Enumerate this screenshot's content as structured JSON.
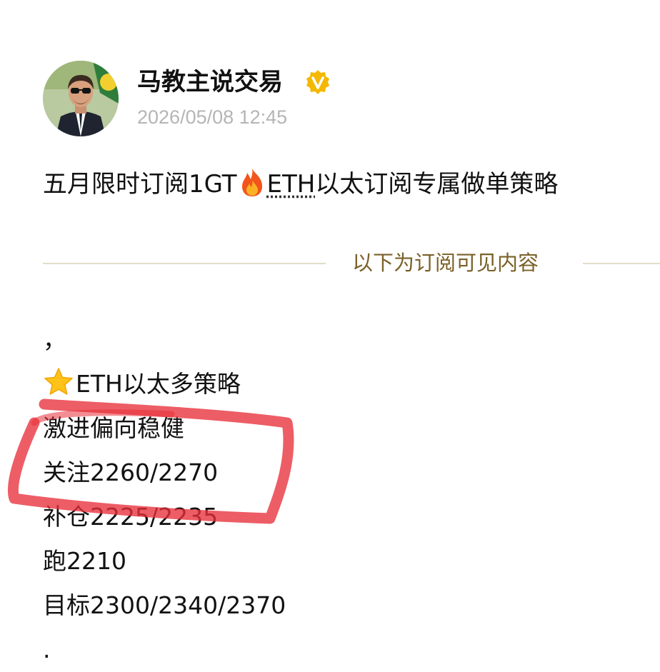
{
  "author": {
    "name": "马教主说交易",
    "verified_badge": "V",
    "timestamp": "2026/05/08 12:45",
    "verified_color": "#f5b800"
  },
  "post": {
    "title_prefix": "五月限时订阅1GT",
    "title_link": "ETH",
    "title_suffix": "以太订阅专属做单策略",
    "fire_icon": "fire-emoji"
  },
  "divider": {
    "label": "以下为订阅可见内容",
    "color": "#7a6128"
  },
  "content": {
    "lines": [
      "，",
      "ETH以太多策略",
      "激进偏向稳健",
      "关注2260/2270",
      "补仓2225/2235",
      "跑2210",
      "目标2300/2340/2370",
      "."
    ],
    "star_icon": "star-emoji"
  },
  "annotation": {
    "color": "#e8303a"
  }
}
